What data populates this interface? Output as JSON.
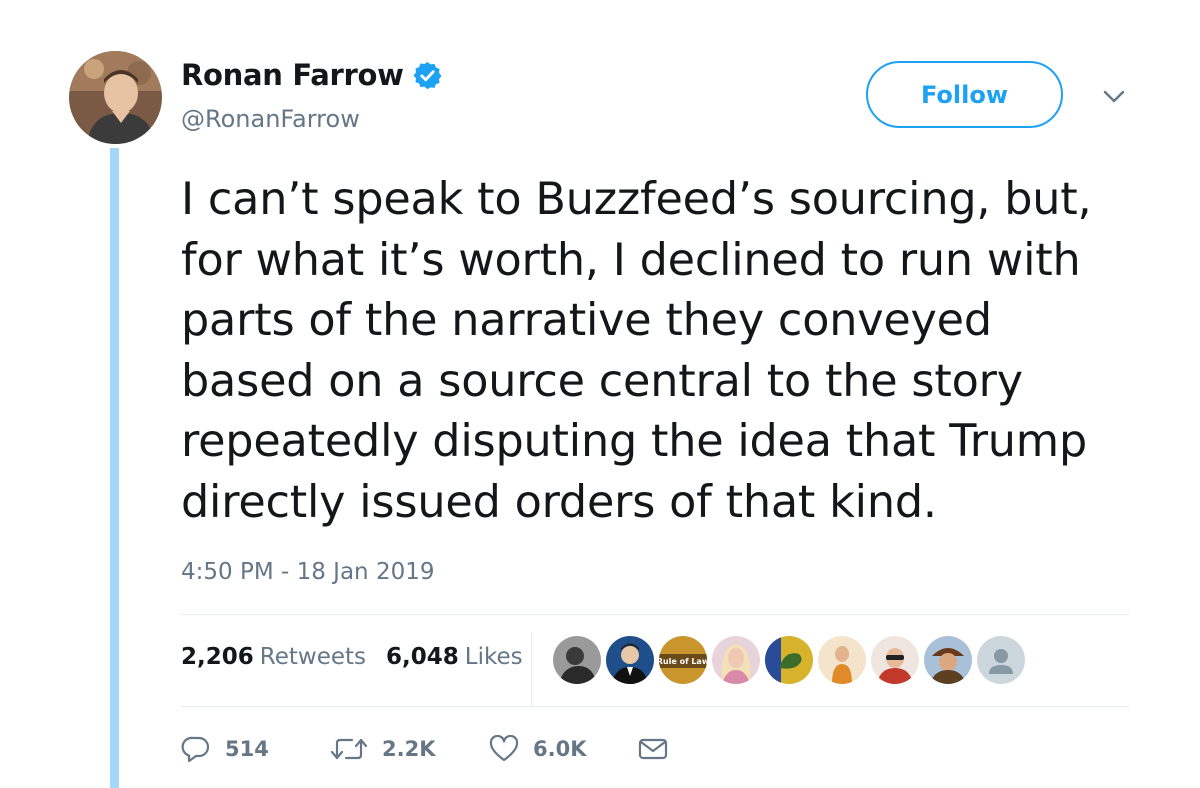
{
  "author": {
    "name": "Ronan Farrow",
    "handle": "@RonanFarrow",
    "verified": true,
    "avatar": "avatar-photo"
  },
  "follow_button": {
    "label": "Follow"
  },
  "menu": {
    "icon": "chevron-down-icon"
  },
  "tweet": {
    "lines": [
      "I can’t speak to Buzzfeed’s sourcing, but,",
      "for what it’s worth, I declined to run with",
      "parts of the narrative they conveyed",
      "based on a source central to the story",
      "repeatedly disputing the idea that Trump",
      "directly issued orders of that kind."
    ],
    "timestamp": "4:50 PM - 18 Jan 2019"
  },
  "stats": {
    "retweets_count": "2,206",
    "retweets_label": "Retweets",
    "likes_count": "6,048",
    "likes_label": "Likes"
  },
  "likers": [
    {
      "icon": "liker-avatar-1",
      "color": "#5a5a5a"
    },
    {
      "icon": "liker-avatar-2",
      "color": "#1f4f8a"
    },
    {
      "icon": "liker-avatar-3",
      "color": "#c9962e",
      "text": "Rule of Law"
    },
    {
      "icon": "liker-avatar-4",
      "color": "#d9a7b8"
    },
    {
      "icon": "liker-avatar-5",
      "color": "#d6b32a"
    },
    {
      "icon": "liker-avatar-6",
      "color": "#e5b58a"
    },
    {
      "icon": "liker-avatar-7",
      "color": "#c0392b"
    },
    {
      "icon": "liker-avatar-8",
      "color": "#8a6a3a"
    },
    {
      "icon": "default-avatar-icon",
      "color": "#ccd6dd"
    }
  ],
  "actions": {
    "replies": "514",
    "retweets": "2.2K",
    "likes": "6.0K"
  },
  "colors": {
    "accent": "#1da1f2",
    "thread_line": "#a6d6f6",
    "secondary_text": "#657786",
    "divider": "#e6ecf0"
  }
}
